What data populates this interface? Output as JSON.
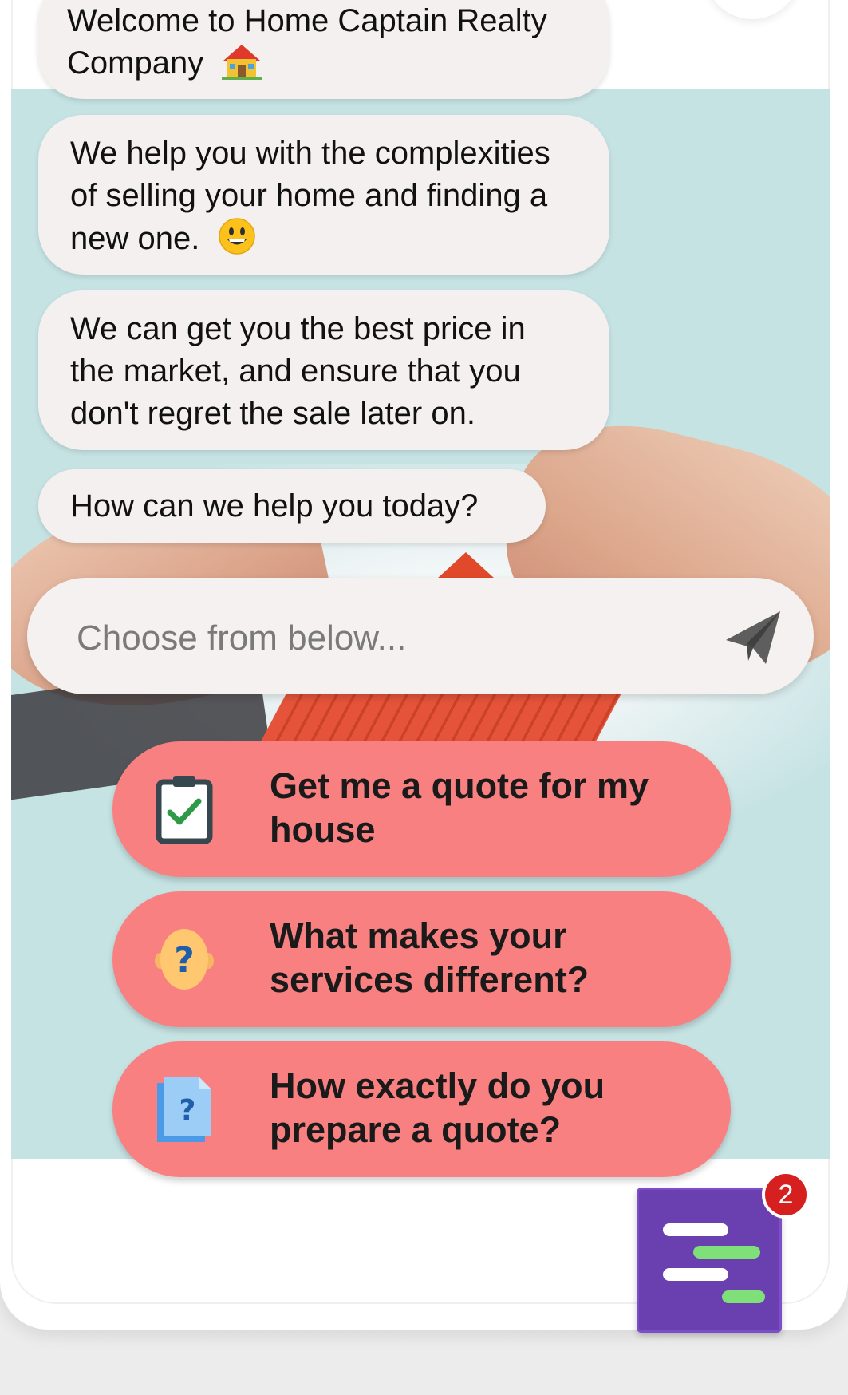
{
  "messages": [
    {
      "text": "Welcome to Home Captain Realty Company",
      "emoji": "house-emoji"
    },
    {
      "text": "We help you with the complexities of selling your home and finding a new one.",
      "emoji": "grinning-face-emoji"
    },
    {
      "text": "We can get you the best price in the market, and ensure that you don't regret the sale later on."
    },
    {
      "text": "How can we help you today?"
    }
  ],
  "composer": {
    "placeholder": "Choose from below..."
  },
  "options": [
    {
      "label": "Get me a quote for my house",
      "icon": "clipboard-check-icon"
    },
    {
      "label": "What makes your services different?",
      "icon": "question-head-icon"
    },
    {
      "label": "How exactly do you prepare a quote?",
      "icon": "document-question-icon"
    }
  ],
  "launcher": {
    "badge_count": "2"
  },
  "colors": {
    "chat_background": "#c6e3e4",
    "bubble": "#f3f0ef",
    "option_button": "#f88080",
    "launcher": "#6a3fb0",
    "badge": "#d62020"
  }
}
